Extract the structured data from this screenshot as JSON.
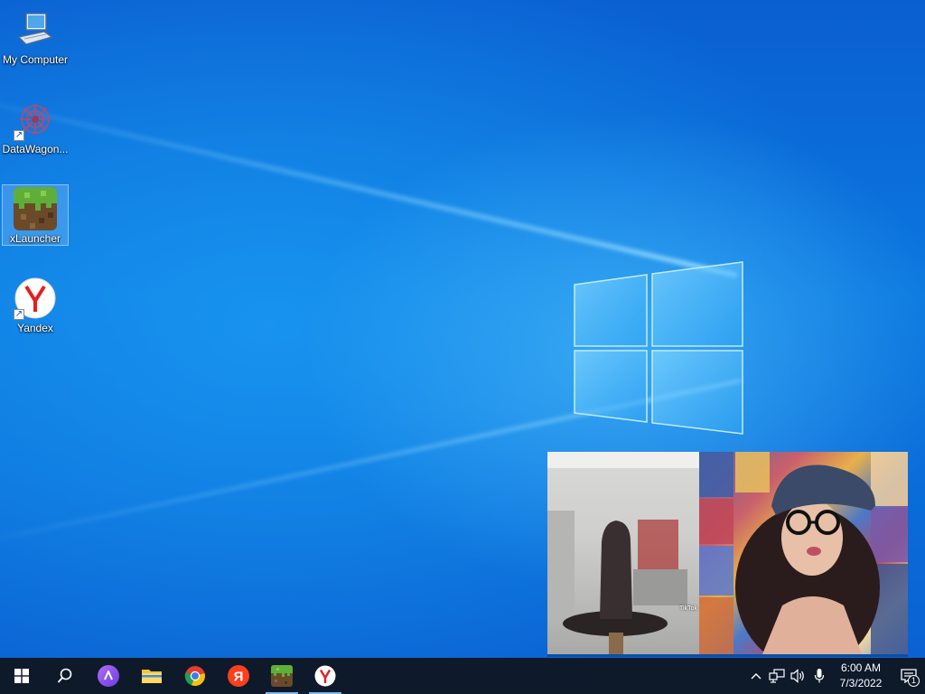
{
  "desktop": {
    "icons": [
      {
        "label": "My Computer",
        "icon": "computer-icon"
      },
      {
        "label": "DataWagon...",
        "icon": "datawagon-icon"
      },
      {
        "label": "xLauncher",
        "icon": "minecraft-grass-block-icon"
      },
      {
        "label": "Yandex",
        "icon": "yandex-browser-icon"
      }
    ]
  },
  "video": {
    "watermark": "TikTok"
  },
  "taskbar": {
    "pinned": [
      {
        "name": "start-button",
        "icon": "windows-logo-icon"
      },
      {
        "name": "search-button",
        "icon": "search-icon"
      },
      {
        "name": "alice-button",
        "icon": "alice-voice-assistant-icon"
      },
      {
        "name": "file-explorer-button",
        "icon": "folder-icon"
      },
      {
        "name": "chrome-button",
        "icon": "chrome-icon"
      },
      {
        "name": "yandex-button",
        "icon": "yandex-letter-icon"
      },
      {
        "name": "xlauncher-button",
        "icon": "minecraft-grass-block-icon"
      },
      {
        "name": "yandex-browser-button",
        "icon": "yandex-browser-icon"
      }
    ],
    "clock": {
      "time": "6:00 AM",
      "date": "7/3/2022"
    },
    "notifications_count": "1"
  },
  "colors": {
    "taskbar": "#0e1a2a",
    "accent": "#79b8f0",
    "wallpaper": "#0a62d2"
  }
}
